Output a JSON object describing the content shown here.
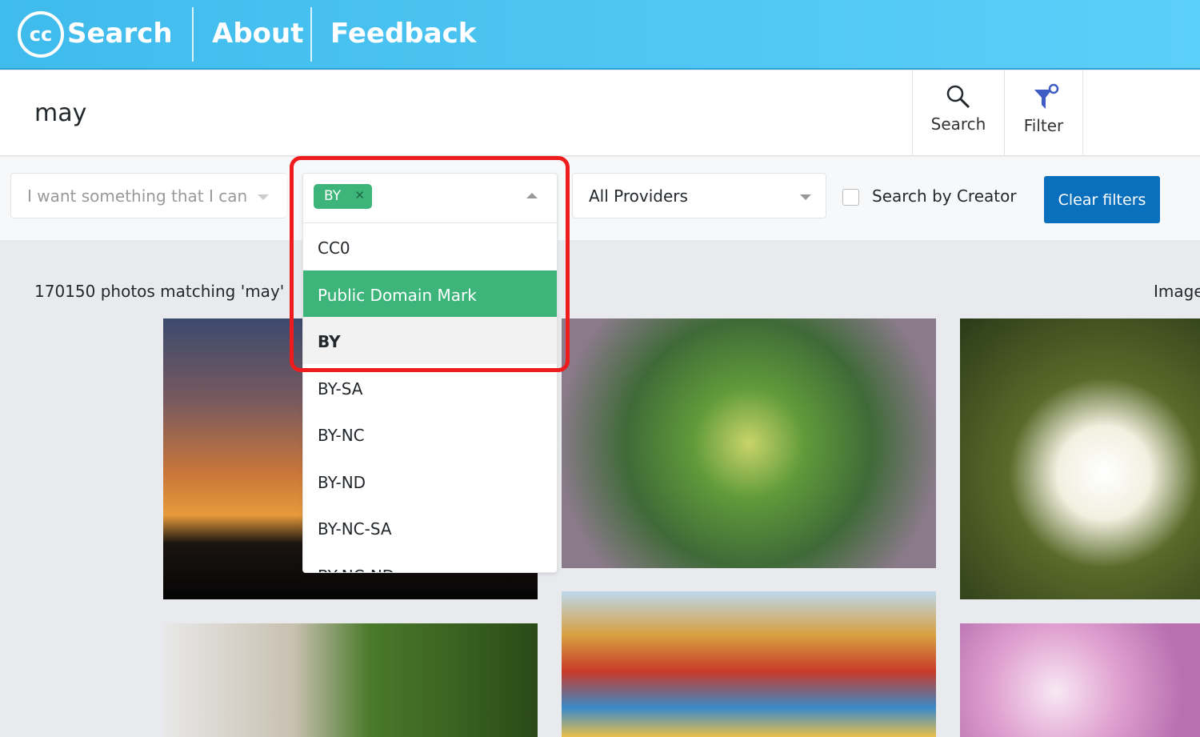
{
  "header": {
    "logo_mark": "cc",
    "logo_text": "Search",
    "nav": [
      "About",
      "Feedback"
    ]
  },
  "search": {
    "query": "may",
    "search_label": "Search",
    "filter_label": "Filter"
  },
  "filters": {
    "use_placeholder": "I want something that I can",
    "license_tag": "BY",
    "providers": "All Providers",
    "creator_label": "Search by Creator",
    "clear_label": "Clear filters",
    "options": [
      "CC0",
      "Public Domain Mark",
      "BY",
      "BY-SA",
      "BY-NC",
      "BY-ND",
      "BY-NC-SA",
      "BY-NC-ND"
    ],
    "highlighted": "Public Domain Mark",
    "selected": "BY"
  },
  "results": {
    "count_text": "170150 photos matching 'may'",
    "right_label": "Image"
  },
  "colors": {
    "header": "#4fc6f4",
    "accent_green": "#3cb47a",
    "button_blue": "#0a6fbc",
    "annotation_red": "#ee1c1c"
  }
}
